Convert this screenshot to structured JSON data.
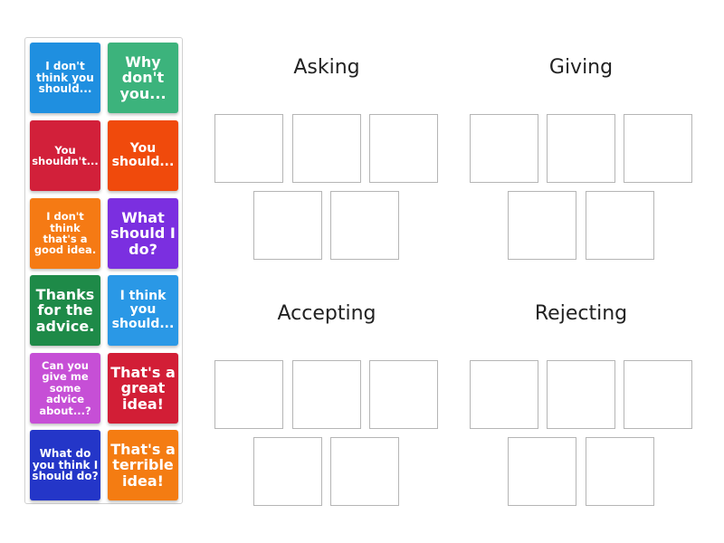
{
  "cards": [
    {
      "text": "I don't think you should...",
      "color": "#1f8fe0"
    },
    {
      "text": "Why don't you...",
      "color": "#3cb37c"
    },
    {
      "text": "You shouldn't...",
      "color": "#d2203a"
    },
    {
      "text": "You should...",
      "color": "#f04a0c"
    },
    {
      "text": "I don't think that's a good idea.",
      "color": "#f57a14"
    },
    {
      "text": "What should I do?",
      "color": "#7b2fe0"
    },
    {
      "text": "Thanks for the advice.",
      "color": "#1e8a48"
    },
    {
      "text": "I think you should...",
      "color": "#2a98e6"
    },
    {
      "text": "Can you give me some advice about...?",
      "color": "#c64fd6"
    },
    {
      "text": "That's a great idea!",
      "color": "#d21e36"
    },
    {
      "text": "What do you think I should do?",
      "color": "#2436c8"
    },
    {
      "text": "That's a terrible idea!",
      "color": "#f47c12"
    }
  ],
  "groups": [
    {
      "title": "Asking",
      "slots": 5
    },
    {
      "title": "Giving",
      "slots": 5
    },
    {
      "title": "Accepting",
      "slots": 5
    },
    {
      "title": "Rejecting",
      "slots": 5
    }
  ]
}
